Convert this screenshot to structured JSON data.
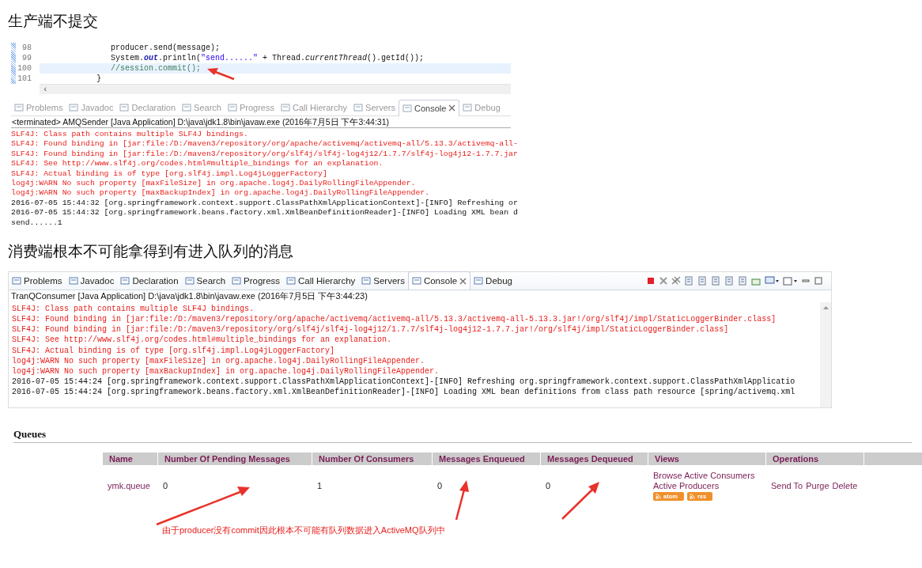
{
  "heading_producer": "生产端不提交",
  "code_editor": {
    "lines": [
      {
        "number": "98",
        "selected": false,
        "tokens": [
          {
            "text": "               producer.send(message);",
            "kind": "plain"
          }
        ]
      },
      {
        "number": "99",
        "selected": false,
        "tokens": [
          {
            "text": "               System.",
            "kind": "plain"
          },
          {
            "text": "out",
            "kind": "field"
          },
          {
            "text": ".println(",
            "kind": "plain"
          },
          {
            "text": "\"send......\"",
            "kind": "string"
          },
          {
            "text": " + Thread.",
            "kind": "plain"
          },
          {
            "text": "currentThread",
            "kind": "italic"
          },
          {
            "text": "().getId());",
            "kind": "plain"
          }
        ]
      },
      {
        "number": "100",
        "selected": true,
        "tokens": [
          {
            "text": "               //session.commit();",
            "kind": "comment"
          }
        ]
      },
      {
        "number": "101",
        "selected": false,
        "tokens": [
          {
            "text": "            }",
            "kind": "plain"
          }
        ]
      }
    ],
    "scroll_left": "‹"
  },
  "producer_console": {
    "focused": false,
    "tabs": [
      {
        "label": "Problems",
        "selected": false
      },
      {
        "label": "Javadoc",
        "selected": false
      },
      {
        "label": "Declaration",
        "selected": false
      },
      {
        "label": "Search",
        "selected": false
      },
      {
        "label": "Progress",
        "selected": false
      },
      {
        "label": "Call Hierarchy",
        "selected": false
      },
      {
        "label": "Servers",
        "selected": false
      },
      {
        "label": "Console",
        "selected": true
      },
      {
        "label": "Debug",
        "selected": false
      }
    ],
    "header": "<terminated> AMQSender [Java Application] D:\\java\\jdk1.8\\bin\\javaw.exe (2016年7月5日 下午3:44:31)",
    "lines": [
      {
        "text": "SLF4J: Class path contains multiple SLF4J bindings.",
        "kind": "error"
      },
      {
        "text": "SLF4J: Found binding in [jar:file:/D:/maven3/repository/org/apache/activemq/activemq-all/5.13.3/activemq-all-",
        "kind": "error"
      },
      {
        "text": "SLF4J: Found binding in [jar:file:/D:/maven3/repository/org/slf4j/slf4j-log4j12/1.7.7/slf4j-log4j12-1.7.7.jar",
        "kind": "error"
      },
      {
        "text": "SLF4J: See http://www.slf4j.org/codes.html#multiple_bindings for an explanation.",
        "kind": "error"
      },
      {
        "text": "SLF4J: Actual binding is of type [org.slf4j.impl.Log4jLoggerFactory]",
        "kind": "error"
      },
      {
        "text": "log4j:WARN No such property [maxFileSize] in org.apache.log4j.DailyRollingFileAppender.",
        "kind": "error"
      },
      {
        "text": "log4j:WARN No such property [maxBackupIndex] in org.apache.log4j.DailyRollingFileAppender.",
        "kind": "error"
      },
      {
        "text": "2016-07-05 15:44:32 [org.springframework.context.support.ClassPathXmlApplicationContext]-[INFO] Refreshing or",
        "kind": "info"
      },
      {
        "text": "2016-07-05 15:44:32 [org.springframework.beans.factory.xml.XmlBeanDefinitionReader]-[INFO] Loading XML bean d",
        "kind": "info"
      },
      {
        "text": "send......1",
        "kind": "info"
      }
    ]
  },
  "heading_consumer": "消费端根本不可能拿得到有进入队列的消息",
  "consumer_console": {
    "focused": true,
    "tabs": [
      {
        "label": "Problems",
        "selected": false
      },
      {
        "label": "Javadoc",
        "selected": false
      },
      {
        "label": "Declaration",
        "selected": false
      },
      {
        "label": "Search",
        "selected": false
      },
      {
        "label": "Progress",
        "selected": false
      },
      {
        "label": "Call Hierarchy",
        "selected": false
      },
      {
        "label": "Servers",
        "selected": false
      },
      {
        "label": "Console",
        "selected": true
      },
      {
        "label": "Debug",
        "selected": false
      }
    ],
    "header": "TranQConsumer [Java Application] D:\\java\\jdk1.8\\bin\\javaw.exe (2016年7月5日 下午3:44:23)",
    "lines": [
      {
        "text": "SLF4J: Class path contains multiple SLF4J bindings.",
        "kind": "error"
      },
      {
        "text": "SLF4J: Found binding in [jar:file:/D:/maven3/repository/org/apache/activemq/activemq-all/5.13.3/activemq-all-5.13.3.jar!/org/slf4j/impl/StaticLoggerBinder.class]",
        "kind": "error"
      },
      {
        "text": "SLF4J: Found binding in [jar:file:/D:/maven3/repository/org/slf4j/slf4j-log4j12/1.7.7/slf4j-log4j12-1.7.7.jar!/org/slf4j/impl/StaticLoggerBinder.class]",
        "kind": "error"
      },
      {
        "text": "SLF4J: See http://www.slf4j.org/codes.html#multiple_bindings for an explanation.",
        "kind": "error"
      },
      {
        "text": "SLF4J: Actual binding is of type [org.slf4j.impl.Log4jLoggerFactory]",
        "kind": "error"
      },
      {
        "text": "log4j:WARN No such property [maxFileSize] in org.apache.log4j.DailyRollingFileAppender.",
        "kind": "error"
      },
      {
        "text": "log4j:WARN No such property [maxBackupIndex] in org.apache.log4j.DailyRollingFileAppender.",
        "kind": "error"
      },
      {
        "text": "2016-07-05 15:44:24 [org.springframework.context.support.ClassPathXmlApplicationContext]-[INFO] Refreshing org.springframework.context.support.ClassPathXmlApplicatio",
        "kind": "info"
      },
      {
        "text": "2016-07-05 15:44:24 [org.springframework.beans.factory.xml.XmlBeanDefinitionReader]-[INFO] Loading XML bean definitions from class path resource [spring/activemq.xml",
        "kind": "info"
      }
    ]
  },
  "queues": {
    "title": "Queues",
    "columns": [
      "Name",
      "Number Of Pending Messages",
      "Number Of Consumers",
      "Messages Enqueued",
      "Messages Dequeued",
      "Views",
      "Operations"
    ],
    "rows": [
      {
        "name": "ymk.queue",
        "pending": "0",
        "consumers": "1",
        "enqueued": "0",
        "dequeued": "0",
        "views": [
          "Browse Active Consumers",
          "Active Producers"
        ],
        "feeds": [
          "atom",
          "rss"
        ],
        "operations": [
          "Send To",
          "Purge",
          "Delete"
        ]
      }
    ]
  },
  "annotation": "由于producer没有commit因此根本不可能有队列数据进入ActiveMQ队列中"
}
